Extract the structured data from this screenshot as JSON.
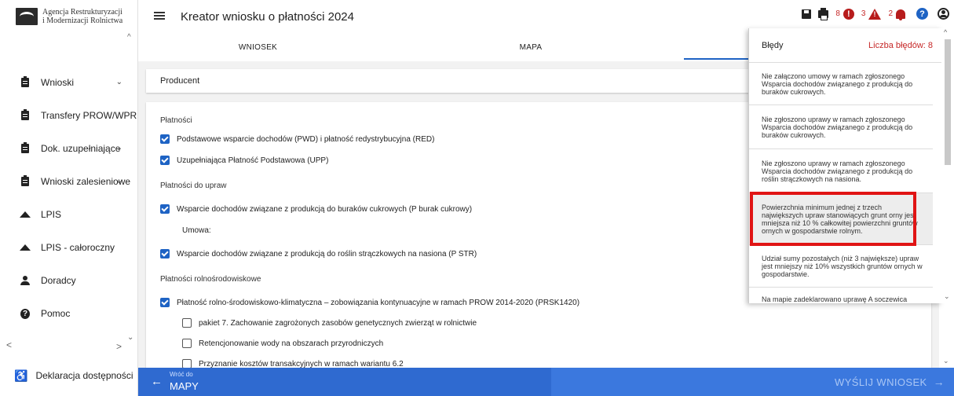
{
  "logo": {
    "line1": "Agencja Restrukturyzacji",
    "line2": "i Modernizacji Rolnictwa"
  },
  "sidebar": {
    "items": [
      {
        "label": "Wnioski",
        "icon": "clipboard-icon",
        "chevron": true
      },
      {
        "label": "Transfery PROW/WPR",
        "icon": "clipboard-icon",
        "chevron": false
      },
      {
        "label": "Dok. uzupełniające",
        "icon": "clipboard-icon",
        "chevron": true
      },
      {
        "label": "Wnioski zalesieniowe",
        "icon": "clipboard-icon",
        "chevron": true
      },
      {
        "label": "LPIS",
        "icon": "mountain-icon",
        "chevron": false
      },
      {
        "label": "LPIS - całoroczny",
        "icon": "mountain-icon",
        "chevron": false
      },
      {
        "label": "Doradcy",
        "icon": "person-icon",
        "chevron": false
      },
      {
        "label": "Pomoc",
        "icon": "help-icon",
        "chevron": false
      }
    ],
    "accessibility": "Deklaracja dostępności"
  },
  "header": {
    "title": "Kreator wniosku o płatności 2024",
    "errors_count": "8",
    "warnings_count": "3",
    "notifications_count": "2"
  },
  "tabs": [
    {
      "label": "WNIOSEK"
    },
    {
      "label": "MAPA"
    },
    {
      "label": ""
    }
  ],
  "main": {
    "producent": "Producent",
    "rows": [
      {
        "type": "section",
        "text": "Płatności"
      },
      {
        "type": "check",
        "checked": true,
        "text": "Podstawowe wsparcie dochodów (PWD) i płatność redystrybucyjna (RED)"
      },
      {
        "type": "check",
        "checked": true,
        "text": "Uzupełniająca Płatność Podstawowa (UPP)"
      },
      {
        "type": "section",
        "text": "Płatności do upraw"
      },
      {
        "type": "check",
        "checked": true,
        "text": "Wsparcie dochodów związane z produkcją do buraków cukrowych (P burak cukrowy)"
      },
      {
        "type": "plain",
        "text": "Umowa:"
      },
      {
        "type": "check",
        "checked": true,
        "text": "Wsparcie dochodów związane z produkcją do roślin strączkowych na nasiona (P STR)"
      },
      {
        "type": "section",
        "text": "Płatności rolnośrodowiskowe"
      },
      {
        "type": "check",
        "checked": true,
        "text": "Płatność rolno-środowiskowo-klimatyczna – zobowiązania kontynuacyjne w ramach PROW 2014-2020 (PRSK1420)"
      },
      {
        "type": "check",
        "checked": false,
        "sub": true,
        "text": "pakiet 7. Zachowanie zagrożonych zasobów genetycznych zwierząt w rolnictwie"
      },
      {
        "type": "check",
        "checked": false,
        "sub": true,
        "text": "Retencjonowanie wody na obszarach przyrodniczych"
      },
      {
        "type": "check",
        "checked": false,
        "sub": true,
        "text": "Przyznanie kosztów transakcyjnych w ramach wariantu 6.2"
      }
    ]
  },
  "errors_panel": {
    "title": "Błędy",
    "count_label": "Liczba błędów: 8",
    "items": [
      {
        "text": "Nie załączono umowy w ramach zgłoszonego Wsparcia dochodów związanego z produkcją do buraków cukrowych.",
        "selected": false
      },
      {
        "text": "Nie zgłoszono uprawy w ramach zgłoszonego Wsparcia dochodów związanego z produkcją do buraków cukrowych.",
        "selected": false
      },
      {
        "text": "Nie zgłoszono uprawy w ramach zgłoszonego Wsparcia dochodów związanego z produkcją do roślin strączkowych na nasiona.",
        "selected": false
      },
      {
        "text": "Powierzchnia minimum jednej z trzech największych upraw stanowiących grunt orny jest mniejsza niż 10 % całkowitej powierzchni gruntów ornych w gospodarstwie rolnym.",
        "selected": true
      },
      {
        "text": "Udział sumy pozostałych (niż 3 największe) upraw jest mniejszy niż 10% wszystkich gruntów ornych w gospodarstwie.",
        "selected": false
      },
      {
        "text": "Na mapie zadeklarowano uprawę A soczewica",
        "selected": false
      }
    ]
  },
  "bottom": {
    "back_small": "Wróć do",
    "back_big": "MAPY",
    "send": "WYŚLIJ WNIOSEK"
  },
  "colors": {
    "accent": "#1e63c4",
    "error": "#b71c1c",
    "highlight": "#e01414",
    "bottom_bar": "#2f6ad0"
  }
}
